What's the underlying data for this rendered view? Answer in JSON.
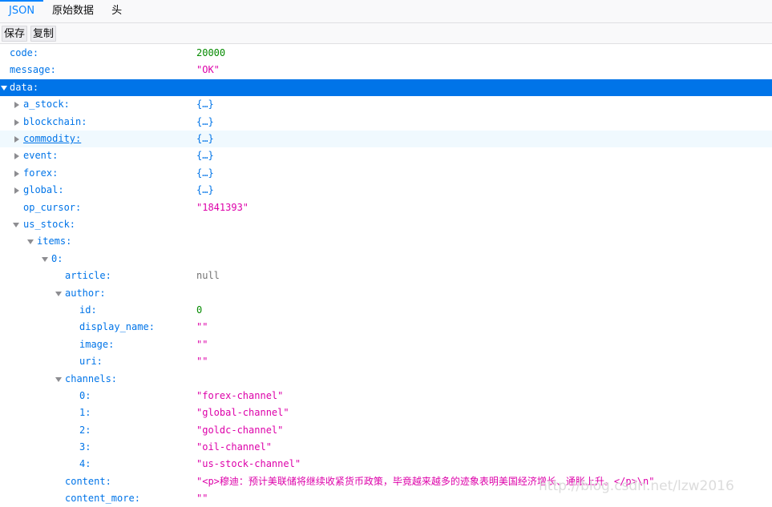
{
  "tabs": [
    {
      "label": "JSON"
    },
    {
      "label": "原始数据"
    },
    {
      "label": "头"
    }
  ],
  "toolbar": {
    "save_label": "保存",
    "copy_label": "复制"
  },
  "rows": [
    {
      "key": "code:",
      "value": "20000",
      "vtype": "num"
    },
    {
      "key": "message:",
      "value": "\"OK\"",
      "vtype": "str"
    },
    {
      "key": "data:",
      "value": "",
      "vtype": "none"
    },
    {
      "key": "a_stock:",
      "value": "{…}",
      "vtype": "obj"
    },
    {
      "key": "blockchain:",
      "value": "{…}",
      "vtype": "obj"
    },
    {
      "key": "commodity:",
      "value": "{…}",
      "vtype": "obj"
    },
    {
      "key": "event:",
      "value": "{…}",
      "vtype": "obj"
    },
    {
      "key": "forex:",
      "value": "{…}",
      "vtype": "obj"
    },
    {
      "key": "global:",
      "value": "{…}",
      "vtype": "obj"
    },
    {
      "key": "op_cursor:",
      "value": "\"1841393\"",
      "vtype": "str"
    },
    {
      "key": "us_stock:",
      "value": "",
      "vtype": "none"
    },
    {
      "key": "items:",
      "value": "",
      "vtype": "none"
    },
    {
      "key": "0:",
      "value": "",
      "vtype": "none"
    },
    {
      "key": "article:",
      "value": "null",
      "vtype": "null"
    },
    {
      "key": "author:",
      "value": "",
      "vtype": "none"
    },
    {
      "key": "id:",
      "value": "0",
      "vtype": "num"
    },
    {
      "key": "display_name:",
      "value": "\"\"",
      "vtype": "str"
    },
    {
      "key": "image:",
      "value": "\"\"",
      "vtype": "str"
    },
    {
      "key": "uri:",
      "value": "\"\"",
      "vtype": "str"
    },
    {
      "key": "channels:",
      "value": "",
      "vtype": "none"
    },
    {
      "key": "0:",
      "value": "\"forex-channel\"",
      "vtype": "str"
    },
    {
      "key": "1:",
      "value": "\"global-channel\"",
      "vtype": "str"
    },
    {
      "key": "2:",
      "value": "\"goldc-channel\"",
      "vtype": "str"
    },
    {
      "key": "3:",
      "value": "\"oil-channel\"",
      "vtype": "str"
    },
    {
      "key": "4:",
      "value": "\"us-stock-channel\"",
      "vtype": "str"
    },
    {
      "key": "content:",
      "value": "\"<p>穆迪：预计美联储将继续收紧货币政策，毕竟越来越多的迹象表明美国经济增长、通胀上升。</p>\\n\"",
      "vtype": "str"
    },
    {
      "key": "content_more:",
      "value": "\"\"",
      "vtype": "str"
    }
  ],
  "watermark": "http://blog.csdn.net/lzw2016",
  "colors": {
    "accent": "#0a84ff",
    "selected_row": "#0074e8",
    "key": "#0074e8",
    "string": "#dd00a9",
    "number": "#058b00",
    "null": "#737373"
  }
}
